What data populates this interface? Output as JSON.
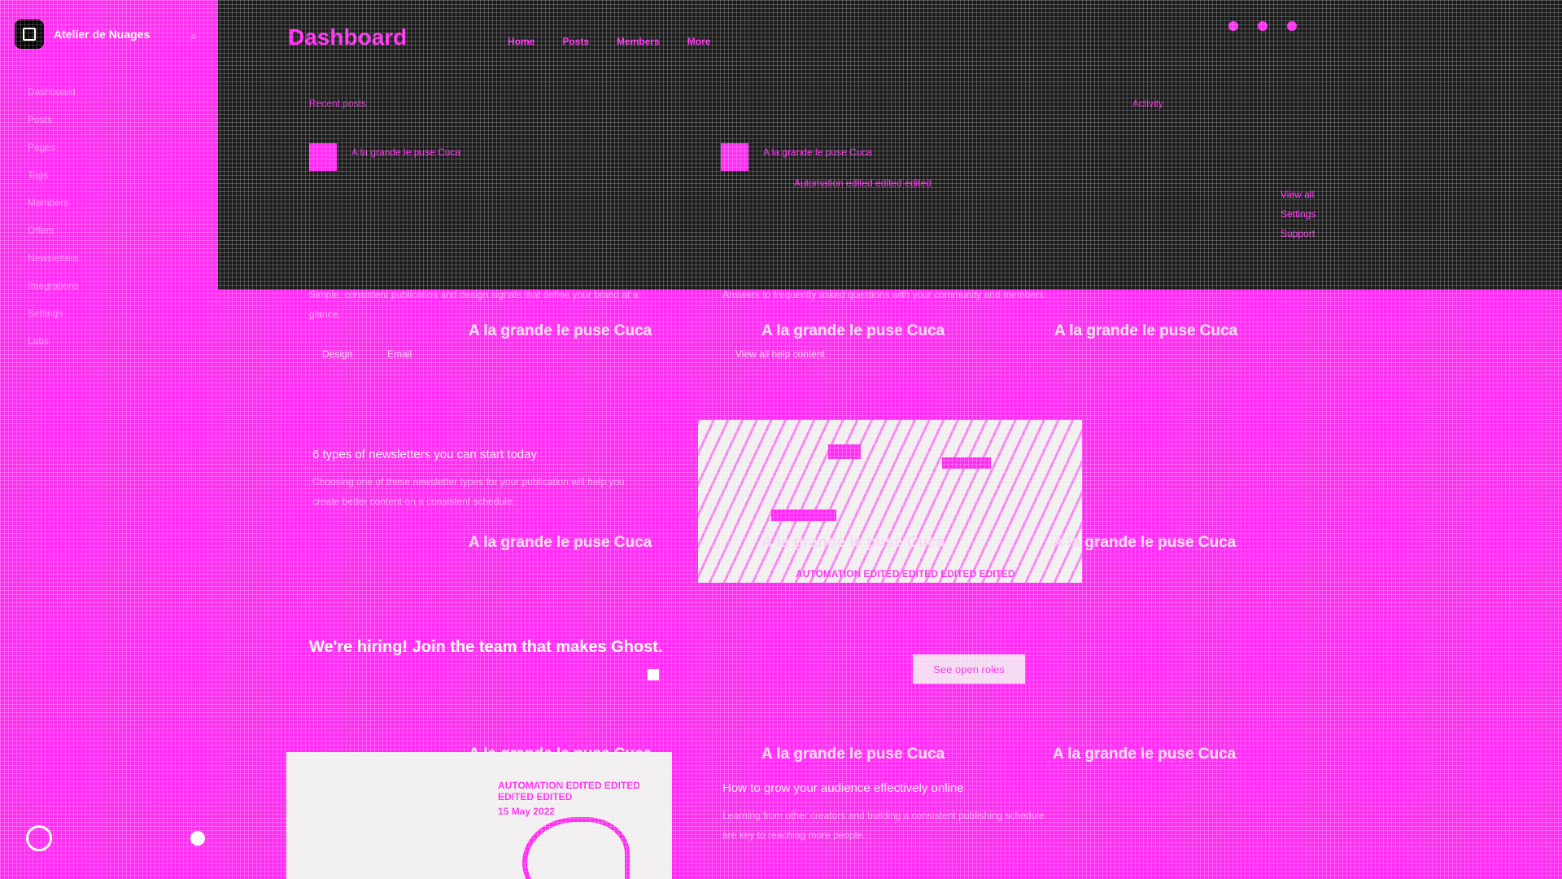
{
  "sidebar": {
    "brand_name": "Atelier de Nuages",
    "nav": [
      "Dashboard",
      "Posts",
      "Pages",
      "Tags",
      "Members",
      "Offers",
      "Newsletters",
      "Integrations",
      "Settings",
      "Labs"
    ]
  },
  "header": {
    "title": "Dashboard",
    "tabs": [
      "Home",
      "Posts",
      "Members",
      "More"
    ]
  },
  "band": {
    "label_left": "Recent posts",
    "label_right": "Activity",
    "item_left_title": "A la grande le puse Cuca",
    "item_right_title": "A la grande le puse Cuca",
    "item_right_sub": "Automation edited edited edited",
    "right_links": [
      "View all",
      "Settings",
      "Support"
    ]
  },
  "content": {
    "para1": "Simple, consistent publication and design signals that define your brand at a glance.",
    "tags": [
      "Design",
      "Email"
    ],
    "para2": "Answers to frequently asked questions with your community and members.",
    "view_link": "View all help content",
    "dup_title": "A la grande le puse Cuca",
    "newsletters_title": "6 types of newsletters you can start today",
    "newsletters_para": "Choosing one of these newsletter types for your publication will help you create better content on a consistent schedule.",
    "photo_caption": "AUTOMATION EDITED EDITED EDITED EDITED",
    "hiring": "We're hiring! Join the team that makes Ghost.",
    "cta": "See open roles",
    "card_meta": "AUTOMATION EDITED EDITED EDITED EDITED",
    "card_date": "15 May 2022",
    "post_title": "How to grow your audience effectively online",
    "post_para": "Learning from other creators and building a consistent publishing schedule are key to reaching more people."
  },
  "colors": {
    "accent": "#ff2cf2",
    "dark": "#1b1b1b",
    "light": "#f1eef0"
  }
}
